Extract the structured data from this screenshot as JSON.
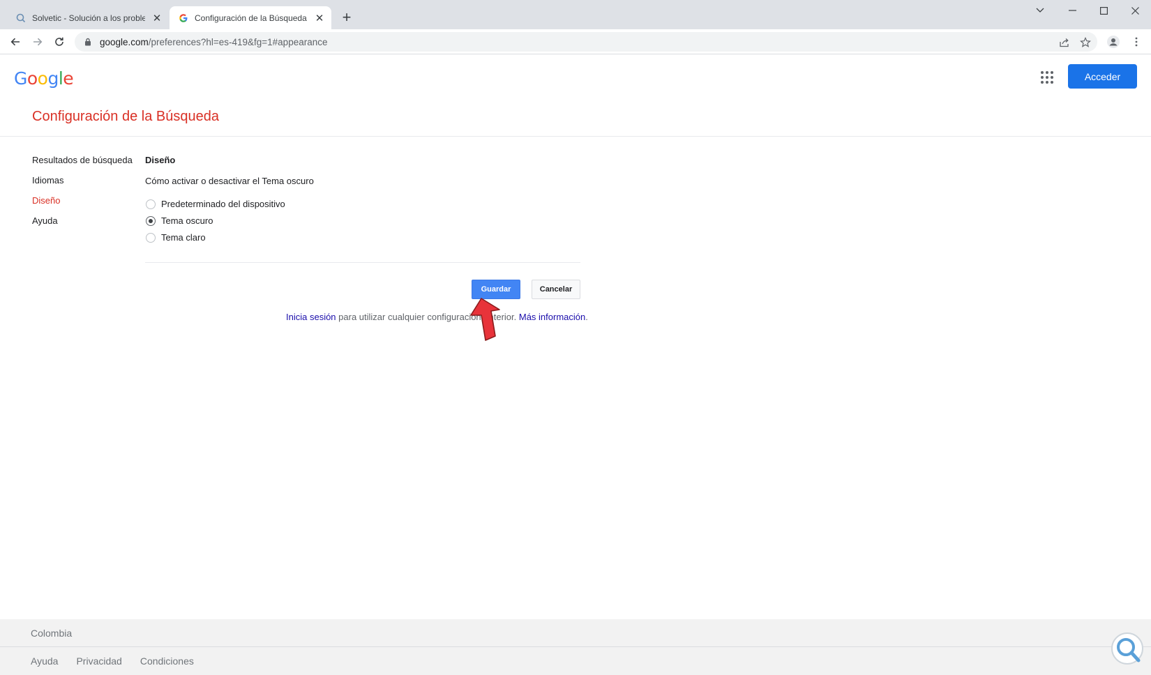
{
  "browser": {
    "tabs": [
      {
        "title": "Solvetic - Solución a los problemas informáticos",
        "active": false
      },
      {
        "title": "Configuración de la Búsqueda",
        "active": true
      }
    ],
    "url_host": "google.com",
    "url_path": "/preferences?hl=es-419&fg=1#appearance"
  },
  "header": {
    "logo_letters": [
      {
        "char": "G",
        "color": "#4285F4"
      },
      {
        "char": "o",
        "color": "#EA4335"
      },
      {
        "char": "o",
        "color": "#FBBC05"
      },
      {
        "char": "g",
        "color": "#4285F4"
      },
      {
        "char": "l",
        "color": "#34A853"
      },
      {
        "char": "e",
        "color": "#EA4335"
      }
    ],
    "signin_label": "Acceder"
  },
  "page": {
    "title": "Configuración de la Búsqueda",
    "nav": [
      "Resultados de búsqueda",
      "Idiomas",
      "Diseño",
      "Ayuda"
    ],
    "active_nav": "Diseño",
    "section": {
      "heading": "Diseño",
      "description": "Cómo activar o desactivar el Tema oscuro",
      "options": [
        {
          "label": "Predeterminado del dispositivo",
          "checked": false
        },
        {
          "label": "Tema oscuro",
          "checked": true
        },
        {
          "label": "Tema claro",
          "checked": false
        }
      ]
    },
    "save_label": "Guardar",
    "cancel_label": "Cancelar",
    "note": {
      "link1": "Inicia sesión",
      "middle": " para utilizar cualquier configuración anterior. ",
      "link2": "Más información",
      "end": "."
    }
  },
  "footer": {
    "country": "Colombia",
    "links": [
      "Ayuda",
      "Privacidad",
      "Condiciones"
    ]
  },
  "colors": {
    "accent_red": "#d93025",
    "primary_blue": "#1a73e8",
    "save_blue": "#4285f4",
    "link_blue": "#1a0dab",
    "annotation_arrow": "#e8333a"
  }
}
